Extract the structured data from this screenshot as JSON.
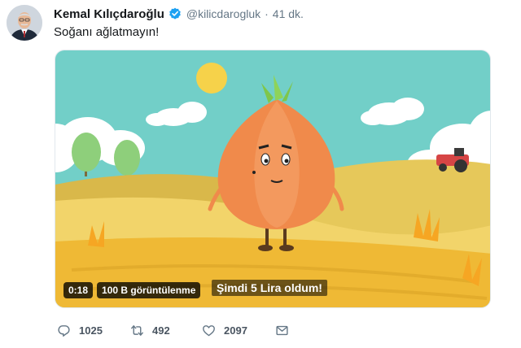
{
  "author": {
    "name": "Kemal Kılıçdaroğlu",
    "handle": "@kilicdarogluk",
    "separator": "·",
    "time": "41 dk."
  },
  "tweet": {
    "text": "Soğanı ağlatmayın!"
  },
  "media": {
    "duration": "0:18",
    "views": "100 B görüntülenme",
    "subtitle": "Şimdi 5 Lira oldum!"
  },
  "actions": {
    "replies": "1025",
    "retweets": "492",
    "likes": "2097"
  },
  "icons": {
    "verified": "verified-badge-icon",
    "reply": "reply-icon",
    "retweet": "retweet-icon",
    "like": "heart-icon",
    "dm": "envelope-icon"
  },
  "colors": {
    "verified": "#1da1f2",
    "action_icon": "#657786",
    "sky": "#6fcfc6",
    "field": "#f2c94c",
    "onion": "#f08a4b"
  }
}
